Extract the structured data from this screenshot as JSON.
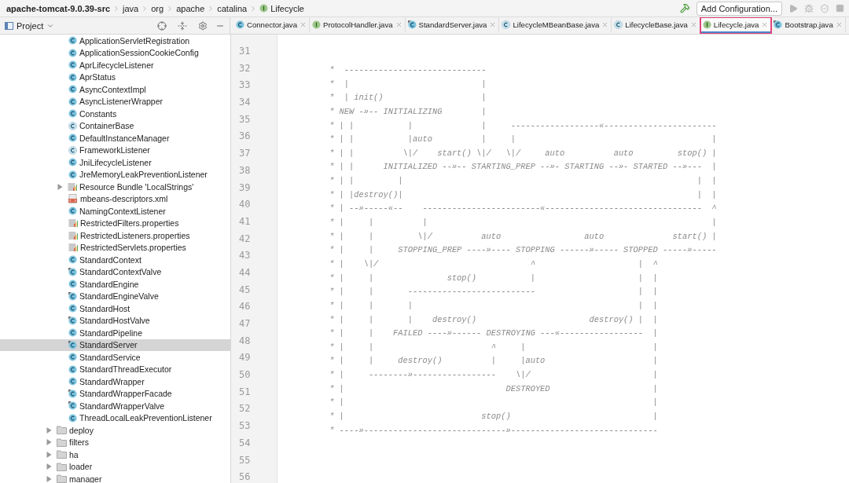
{
  "breadcrumb": {
    "project": "apache-tomcat-9.0.39-src",
    "path": [
      "java",
      "org",
      "apache",
      "catalina"
    ],
    "current": "Lifecycle"
  },
  "toolbar": {
    "run_config": "Add Configuration..."
  },
  "sidebar": {
    "title": "Project",
    "files": [
      {
        "name": "ApplicationServletRegistration",
        "kind": "class",
        "selected": false
      },
      {
        "name": "ApplicationSessionCookieConfig",
        "kind": "class",
        "selected": false
      },
      {
        "name": "AprLifecycleListener",
        "kind": "class",
        "selected": false
      },
      {
        "name": "AprStatus",
        "kind": "class",
        "selected": false
      },
      {
        "name": "AsyncContextImpl",
        "kind": "class",
        "selected": false
      },
      {
        "name": "AsyncListenerWrapper",
        "kind": "class",
        "selected": false
      },
      {
        "name": "Constants",
        "kind": "class",
        "selected": false
      },
      {
        "name": "ContainerBase",
        "kind": "abstract-class",
        "selected": false
      },
      {
        "name": "DefaultInstanceManager",
        "kind": "class",
        "selected": false
      },
      {
        "name": "FrameworkListener",
        "kind": "abstract-class",
        "selected": false
      },
      {
        "name": "JniLifecycleListener",
        "kind": "class",
        "selected": false
      },
      {
        "name": "JreMemoryLeakPreventionListener",
        "kind": "class",
        "selected": false
      },
      {
        "name": "Resource Bundle 'LocalStrings'",
        "kind": "bundle",
        "expanded": false,
        "selected": false
      },
      {
        "name": "mbeans-descriptors.xml",
        "kind": "xml",
        "selected": false
      },
      {
        "name": "NamingContextListener",
        "kind": "class",
        "selected": false
      },
      {
        "name": "RestrictedFilters.properties",
        "kind": "properties",
        "selected": false
      },
      {
        "name": "RestrictedListeners.properties",
        "kind": "properties",
        "selected": false
      },
      {
        "name": "RestrictedServlets.properties",
        "kind": "properties",
        "selected": false
      },
      {
        "name": "StandardContext",
        "kind": "class",
        "selected": false
      },
      {
        "name": "StandardContextValve",
        "kind": "marked-class",
        "selected": false
      },
      {
        "name": "StandardEngine",
        "kind": "class",
        "selected": false
      },
      {
        "name": "StandardEngineValve",
        "kind": "marked-class",
        "selected": false
      },
      {
        "name": "StandardHost",
        "kind": "class",
        "selected": false
      },
      {
        "name": "StandardHostValve",
        "kind": "marked-class",
        "selected": false
      },
      {
        "name": "StandardPipeline",
        "kind": "class",
        "selected": false
      },
      {
        "name": "StandardServer",
        "kind": "marked-class",
        "selected": true
      },
      {
        "name": "StandardService",
        "kind": "class",
        "selected": false
      },
      {
        "name": "StandardThreadExecutor",
        "kind": "class",
        "selected": false
      },
      {
        "name": "StandardWrapper",
        "kind": "class",
        "selected": false
      },
      {
        "name": "StandardWrapperFacade",
        "kind": "marked-class",
        "selected": false
      },
      {
        "name": "StandardWrapperValve",
        "kind": "marked-class",
        "selected": false
      },
      {
        "name": "ThreadLocalLeakPreventionListener",
        "kind": "class",
        "selected": false
      }
    ],
    "folders": [
      {
        "name": "deploy",
        "expanded": false,
        "selected": false
      },
      {
        "name": "filters",
        "expanded": false,
        "selected": false
      },
      {
        "name": "ha",
        "expanded": false,
        "selected": false
      },
      {
        "name": "loader",
        "expanded": false,
        "selected": false
      },
      {
        "name": "manager",
        "expanded": false,
        "selected": false
      }
    ]
  },
  "tabs": [
    {
      "label": "Connector.java",
      "kind": "class",
      "selected": false,
      "outlined": false
    },
    {
      "label": "ProtocolHandler.java",
      "kind": "interface",
      "selected": false,
      "outlined": false
    },
    {
      "label": "StandardServer.java",
      "kind": "marked-class",
      "selected": false,
      "outlined": false
    },
    {
      "label": "LifecycleMBeanBase.java",
      "kind": "abstract-class",
      "selected": false,
      "outlined": false
    },
    {
      "label": "LifecycleBase.java",
      "kind": "abstract-class",
      "selected": false,
      "outlined": false
    },
    {
      "label": "Lifecycle.java",
      "kind": "interface",
      "selected": true,
      "outlined": true
    },
    {
      "label": "Bootstrap.java",
      "kind": "marked-class",
      "selected": false,
      "outlined": false
    }
  ],
  "editor": {
    "line_numbers": [
      "31",
      "32",
      "33",
      "34",
      "35",
      "36",
      "37",
      "38",
      "39",
      "40",
      "41",
      "42",
      "43",
      "44",
      "45",
      "46",
      "47",
      "48",
      "49",
      "50",
      "51",
      "52",
      "53",
      "54",
      "55",
      "56"
    ],
    "comment_lines": [
      "*  -----------------------------",
      "*  |                           |",
      "*  | init()                    |",
      "* NEW -»-- INITIALIZING        |",
      "* | |           |              |     ------------------«-----------------------",
      "* | |           |auto          |     |                                        |",
      "* | |          \\|/    start() \\|/   \\|/     auto          auto         stop() |",
      "* | |      INITIALIZED --»-- STARTING_PREP --»- STARTING --»- STARTED --»---  |",
      "* | |         |                                                            |  |",
      "* | |destroy()|                                                            |  |",
      "* | --»-----«--    ------------------------«--------------------------------  ^",
      "* |     |          |                                                          |",
      "* |     |         \\|/          auto                 auto              start() |",
      "* |     |     STOPPING_PREP ----»---- STOPPING ------»----- STOPPED -----»-----",
      "* |    \\|/                               ^                     |  ^",
      "* |     |               stop()           |                     |  |",
      "* |     |       --------------------------                     |  |",
      "* |     |       |                                              |  |",
      "* |     |       |    destroy()                       destroy() |  |",
      "* |     |    FAILED ----»------ DESTROYING ---«-----------------  |",
      "* |     |                        ^     |                          |",
      "* |     |     destroy()          |     |auto                      |",
      "* |     --------»-----------------    \\|/                         |",
      "* |                                 DESTROYED                     |",
      "* |                                                               |",
      "* |                            stop()                             |",
      "* ----»-----------------------------»------------------------------"
    ]
  }
}
